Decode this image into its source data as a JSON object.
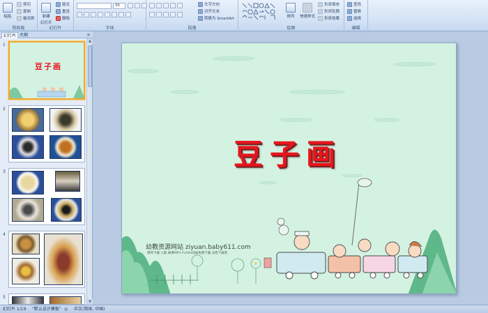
{
  "ribbon": {
    "clipboard": {
      "label": "剪贴板",
      "paste": "粘贴",
      "cut": "剪切",
      "copy": "复制",
      "format": "格式刷"
    },
    "slides": {
      "label": "幻灯片",
      "new": "新建",
      "new2": "幻灯片",
      "layout": "版式",
      "reset": "重设",
      "delete": "删除"
    },
    "font": {
      "label": "字体",
      "size_value": "96"
    },
    "paragraph": {
      "label": "段落",
      "text_dir": "文字方向",
      "align_text": "对齐文本",
      "smartart": "转换为 SmartArt"
    },
    "drawing": {
      "label": "绘图",
      "arrange": "排列",
      "quick_styles": "快速样式",
      "fill": "形状填充",
      "outline": "形状轮廓",
      "effects": "形状效果"
    },
    "editing": {
      "label": "编辑",
      "find": "查找",
      "replace": "替换",
      "select": "选择"
    }
  },
  "panel": {
    "tab_outline": "幻灯片",
    "tab_outline2": "大纲",
    "close": "×",
    "thumb1_title": "豆子画",
    "slide_numbers": [
      "1",
      "2",
      "3",
      "4",
      "5"
    ]
  },
  "slide": {
    "title": "豆子画",
    "watermark": "幼教资源网站  ziyuan.baby611.com",
    "watermark_sub": "课件下载 儿歌 故事MP3 FLASH动画免费下载 试卷下载等"
  },
  "status": {
    "slide_info": "幻灯片 1/19",
    "theme": "\"默认设计模板\"",
    "language": "中文(简体, 中国)"
  },
  "colors": {
    "title_red": "#e8151c",
    "slide_bg": "#d4f2e2",
    "ribbon_bg": "#d3e2f4"
  }
}
